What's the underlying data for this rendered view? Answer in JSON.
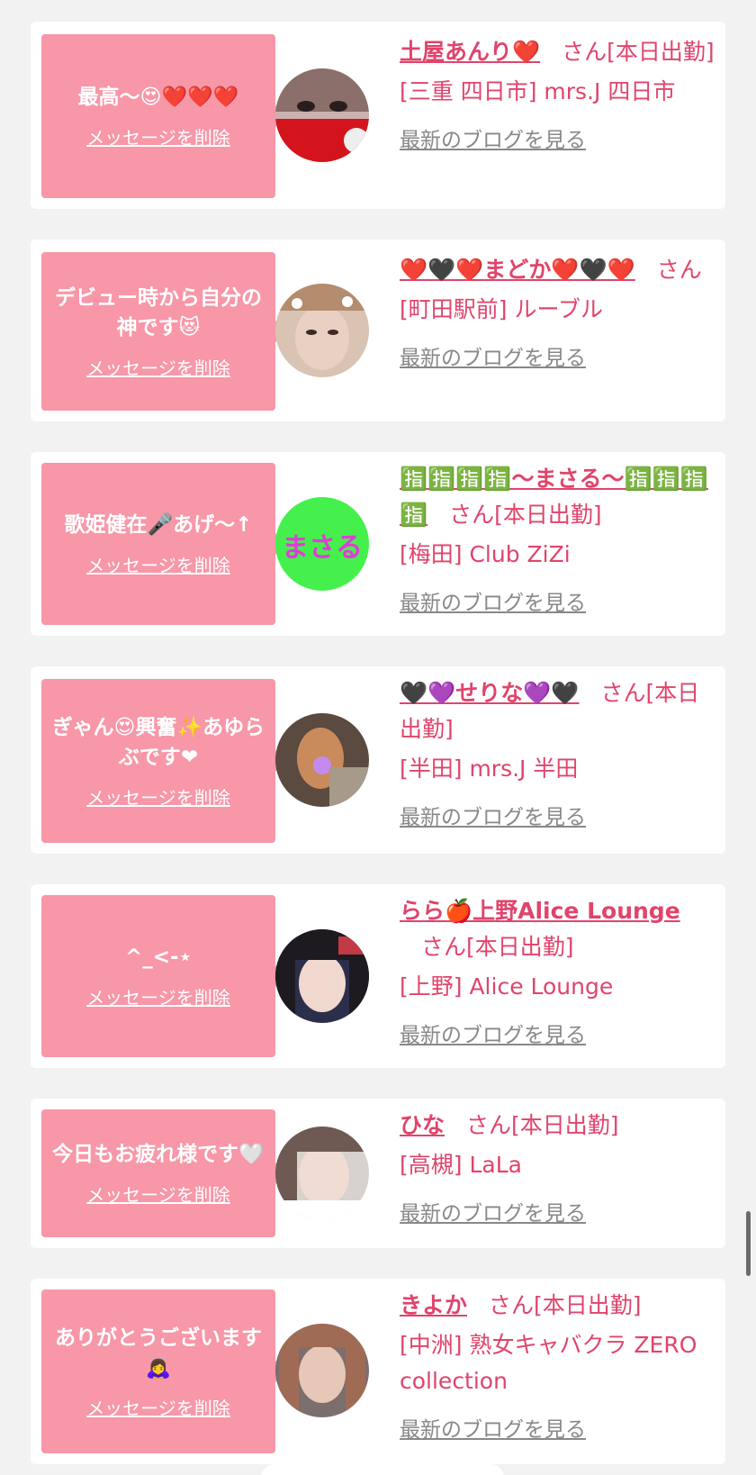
{
  "delete_label": "メッセージを削除",
  "blog_label": "最新のブログを見る",
  "san_label": "さん",
  "cards": [
    {
      "message": "最高〜😍❤️❤️❤️",
      "name": "土屋あんり❤️",
      "status": "[本日出勤]",
      "shop": "[三重 四日市] mrs.J 四日市",
      "avatar": "avatar-anri"
    },
    {
      "message": "デビュー時から自分の神です😻",
      "name": "❤️🖤❤️まどか❤️🖤❤️",
      "status": "",
      "shop": "[町田駅前] ルーブル",
      "avatar": "avatar-madoka"
    },
    {
      "message": "歌姫健在🎤あげ〜↑",
      "name": "🈯🈯🈯🈯〜まさる〜🈯🈯🈯🈯",
      "status": "[本日出勤]",
      "shop": "[梅田] Club ZiZi",
      "avatar": "avatar-masaru"
    },
    {
      "message": "ぎゃん😍興奮✨あゆらぶです❤",
      "name": "🖤💜せりな💜🖤",
      "status": "[本日出勤]",
      "shop": "[半田] mrs.J 半田",
      "avatar": "avatar-serina"
    },
    {
      "message": "^_<-⋆",
      "name": "らら🍎上野Alice Lounge",
      "status": "[本日出勤]",
      "shop": "[上野] Alice Lounge",
      "avatar": "avatar-lala"
    },
    {
      "message": "今日もお疲れ様です🤍",
      "name": "ひな",
      "status": "[本日出勤]",
      "shop": "[高槻] LaLa",
      "avatar": "avatar-hina"
    },
    {
      "message": "ありがとうございます🙇‍♀️",
      "name": "きよか",
      "status": "[本日出勤]",
      "shop": "[中洲] 熟女キャバクラ ZERO collection",
      "avatar": "avatar-kiyoka"
    }
  ]
}
